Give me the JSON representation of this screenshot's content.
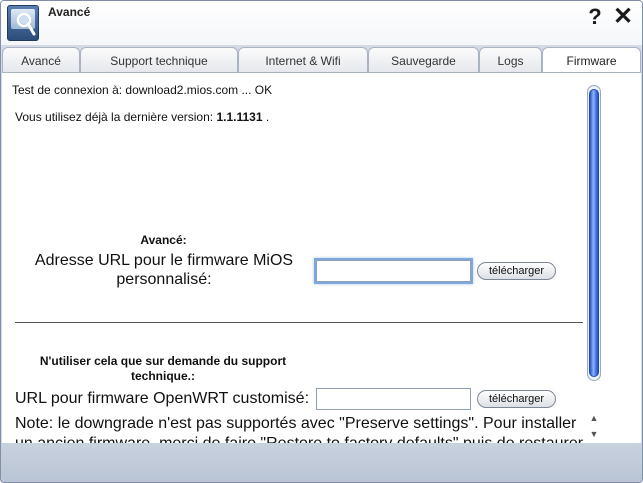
{
  "window": {
    "title": "Avancé",
    "help_label": "?",
    "close_label": "✕"
  },
  "tabs": [
    {
      "label": "Avancé",
      "active": false
    },
    {
      "label": "Support technique",
      "active": false
    },
    {
      "label": "Internet & Wifi",
      "active": false
    },
    {
      "label": "Sauvegarde",
      "active": false
    },
    {
      "label": "Logs",
      "active": false
    },
    {
      "label": "Firmware",
      "active": true
    }
  ],
  "firmware": {
    "connection_test": "Test de connexion à: download2.mios.com ... OK",
    "version_prefix": "Vous utilisez déjà la dernière version:",
    "version_number": "1.1.1131",
    "version_suffix": ".",
    "advanced_section_title": "Avancé:",
    "custom_url_label": "Adresse URL pour le firmware MiOS personnalisé:",
    "custom_url_value": "",
    "download_label": "télécharger",
    "support_section_title": "N'utiliser cela que sur demande du support technique.:",
    "openwrt_url_label": "URL pour firmware OpenWRT customisé:",
    "openwrt_url_value": "",
    "download_label_2": "télécharger",
    "note": "Note: le downgrade n'est pas supportés avec \"Preserve settings\". Pour installer un ancien firmware, merci de faire \"Restore to factory defaults\" puis de restaurer"
  },
  "scrollbar": {
    "up_arrow": "▲",
    "down_arrow": "▼"
  },
  "colors": {
    "scroll_thumb": "#2a58c7",
    "window_bg": "#d4dbe6",
    "focus_ring": "#7fa8de"
  },
  "icons": [
    "app-monitor-magnifier-icon",
    "help-icon",
    "close-icon"
  ]
}
